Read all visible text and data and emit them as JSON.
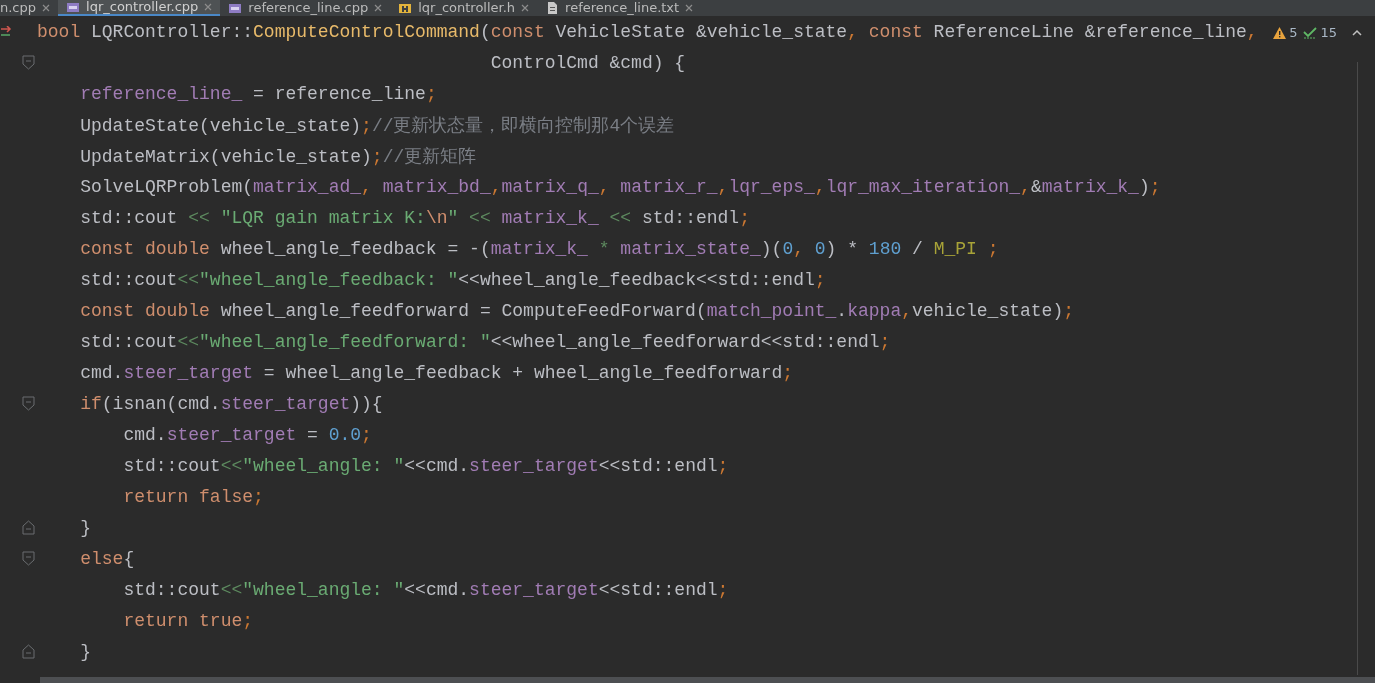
{
  "tabs": [
    {
      "label": "n.cpp",
      "selected": false
    },
    {
      "label": "lqr_controller.cpp",
      "selected": true,
      "kind": "cpp"
    },
    {
      "label": "reference_line.cpp",
      "selected": false,
      "kind": "cpp"
    },
    {
      "label": "lqr_controller.h",
      "selected": false,
      "kind": "h"
    },
    {
      "label": "reference_line.txt",
      "selected": false,
      "kind": "txt"
    }
  ],
  "inspections": {
    "warnings": "5",
    "weak_warnings": "15"
  },
  "lines": [
    {
      "gutter_arrow": true,
      "tokens": [
        {
          "kind": "kw",
          "text": "bool "
        },
        {
          "kind": "plain",
          "text": "LQRController::"
        },
        {
          "kind": "fn",
          "text": "ComputeControlCommand"
        },
        {
          "kind": "plain",
          "text": "("
        },
        {
          "kind": "kw",
          "text": "const "
        },
        {
          "kind": "plain",
          "text": "VehicleState &vehicle_state"
        },
        {
          "kind": "semi",
          "text": ", "
        },
        {
          "kind": "kw",
          "text": "const "
        },
        {
          "kind": "plain",
          "text": "ReferenceLine &reference_line"
        },
        {
          "kind": "semi",
          "text": ","
        }
      ]
    },
    {
      "fold_start": true,
      "tokens": [
        {
          "kind": "plain",
          "text": "                                          ControlCmd &cmd) {"
        }
      ]
    },
    {
      "tokens": [
        {
          "kind": "member",
          "text": "    reference_line_"
        },
        {
          "kind": "plain",
          "text": " = reference_line"
        },
        {
          "kind": "semi",
          "text": ";"
        }
      ]
    },
    {
      "tokens": [
        {
          "kind": "plain",
          "text": "    UpdateState(vehicle_state)"
        },
        {
          "kind": "semi",
          "text": ";"
        },
        {
          "kind": "comment",
          "text": "//更新状态量，即横向控制那4个误差"
        }
      ]
    },
    {
      "tokens": [
        {
          "kind": "plain",
          "text": "    UpdateMatrix(vehicle_state)"
        },
        {
          "kind": "semi",
          "text": ";"
        },
        {
          "kind": "comment",
          "text": "//更新矩阵"
        }
      ]
    },
    {
      "tokens": [
        {
          "kind": "plain",
          "text": "    SolveLQRProblem("
        },
        {
          "kind": "member",
          "text": "matrix_ad_"
        },
        {
          "kind": "semi",
          "text": ", "
        },
        {
          "kind": "member",
          "text": "matrix_bd_"
        },
        {
          "kind": "semi",
          "text": ","
        },
        {
          "kind": "member",
          "text": "matrix_q_"
        },
        {
          "kind": "semi",
          "text": ", "
        },
        {
          "kind": "member",
          "text": "matrix_r_"
        },
        {
          "kind": "semi",
          "text": ","
        },
        {
          "kind": "member",
          "text": "lqr_eps_"
        },
        {
          "kind": "semi",
          "text": ","
        },
        {
          "kind": "member",
          "text": "lqr_max_iteration_"
        },
        {
          "kind": "semi",
          "text": ","
        },
        {
          "kind": "plain",
          "text": "&"
        },
        {
          "kind": "member",
          "text": "matrix_k_"
        },
        {
          "kind": "plain",
          "text": ")"
        },
        {
          "kind": "semi",
          "text": ";"
        }
      ]
    },
    {
      "tokens": [
        {
          "kind": "plain",
          "text": "    std::cout "
        },
        {
          "kind": "op",
          "text": "<< "
        },
        {
          "kind": "str",
          "text": "\"LQR gain matrix K:"
        },
        {
          "kind": "esc",
          "text": "\\n"
        },
        {
          "kind": "str",
          "text": "\" "
        },
        {
          "kind": "op",
          "text": "<< "
        },
        {
          "kind": "member",
          "text": "matrix_k_ "
        },
        {
          "kind": "op",
          "text": "<< "
        },
        {
          "kind": "plain",
          "text": "std::endl"
        },
        {
          "kind": "semi",
          "text": ";"
        }
      ]
    },
    {
      "tokens": [
        {
          "kind": "kw",
          "text": "    const double "
        },
        {
          "kind": "plain",
          "text": "wheel_angle_feedback = -("
        },
        {
          "kind": "member",
          "text": "matrix_k_ "
        },
        {
          "kind": "op",
          "text": "* "
        },
        {
          "kind": "member",
          "text": "matrix_state_"
        },
        {
          "kind": "plain",
          "text": ")("
        },
        {
          "kind": "num",
          "text": "0"
        },
        {
          "kind": "semi",
          "text": ", "
        },
        {
          "kind": "num",
          "text": "0"
        },
        {
          "kind": "plain",
          "text": ") * "
        },
        {
          "kind": "num",
          "text": "180 "
        },
        {
          "kind": "plain",
          "text": "/ "
        },
        {
          "kind": "macro",
          "text": "M_PI "
        },
        {
          "kind": "semi",
          "text": ";"
        }
      ]
    },
    {
      "tokens": [
        {
          "kind": "plain",
          "text": "    std::cout"
        },
        {
          "kind": "op",
          "text": "<<"
        },
        {
          "kind": "str",
          "text": "\"wheel_angle_feedback: \""
        },
        {
          "kind": "plain",
          "text": "<<wheel_angle_feedback<<std::endl"
        },
        {
          "kind": "semi",
          "text": ";"
        }
      ]
    },
    {
      "tokens": [
        {
          "kind": "kw",
          "text": "    const double "
        },
        {
          "kind": "plain",
          "text": "wheel_angle_feedforward = ComputeFeedForward("
        },
        {
          "kind": "member",
          "text": "match_point_"
        },
        {
          "kind": "plain",
          "text": "."
        },
        {
          "kind": "member",
          "text": "kappa"
        },
        {
          "kind": "semi",
          "text": ","
        },
        {
          "kind": "plain",
          "text": "vehicle_state)"
        },
        {
          "kind": "semi",
          "text": ";"
        }
      ]
    },
    {
      "tokens": [
        {
          "kind": "plain",
          "text": "    std::cout"
        },
        {
          "kind": "op",
          "text": "<<"
        },
        {
          "kind": "str",
          "text": "\"wheel_angle_feedforward: \""
        },
        {
          "kind": "plain",
          "text": "<<wheel_angle_feedforward<<std::endl"
        },
        {
          "kind": "semi",
          "text": ";"
        }
      ]
    },
    {
      "tokens": [
        {
          "kind": "plain",
          "text": "    cmd."
        },
        {
          "kind": "member",
          "text": "steer_target"
        },
        {
          "kind": "plain",
          "text": " = wheel_angle_feedback + wheel_angle_feedforward"
        },
        {
          "kind": "semi",
          "text": ";"
        }
      ]
    },
    {
      "fold_start": true,
      "tokens": [
        {
          "kind": "kw",
          "text": "    if"
        },
        {
          "kind": "plain",
          "text": "(isnan(cmd."
        },
        {
          "kind": "member",
          "text": "steer_target"
        },
        {
          "kind": "plain",
          "text": ")){"
        }
      ]
    },
    {
      "tokens": [
        {
          "kind": "plain",
          "text": "        cmd."
        },
        {
          "kind": "member",
          "text": "steer_target"
        },
        {
          "kind": "plain",
          "text": " = "
        },
        {
          "kind": "num",
          "text": "0.0"
        },
        {
          "kind": "semi",
          "text": ";"
        }
      ]
    },
    {
      "tokens": [
        {
          "kind": "plain",
          "text": "        std::cout"
        },
        {
          "kind": "op",
          "text": "<<"
        },
        {
          "kind": "str",
          "text": "\"wheel_angle: \""
        },
        {
          "kind": "plain",
          "text": "<<cmd."
        },
        {
          "kind": "member",
          "text": "steer_target"
        },
        {
          "kind": "plain",
          "text": "<<std::endl"
        },
        {
          "kind": "semi",
          "text": ";"
        }
      ]
    },
    {
      "tokens": [
        {
          "kind": "kw",
          "text": "        return false"
        },
        {
          "kind": "semi",
          "text": ";"
        }
      ]
    },
    {
      "fold_end": true,
      "tokens": [
        {
          "kind": "plain",
          "text": "    }"
        }
      ]
    },
    {
      "fold_start": true,
      "tokens": [
        {
          "kind": "kw",
          "text": "    else"
        },
        {
          "kind": "plain",
          "text": "{"
        }
      ]
    },
    {
      "tokens": [
        {
          "kind": "plain",
          "text": "        std::cout"
        },
        {
          "kind": "op",
          "text": "<<"
        },
        {
          "kind": "str",
          "text": "\"wheel_angle: \""
        },
        {
          "kind": "plain",
          "text": "<<cmd."
        },
        {
          "kind": "member",
          "text": "steer_target"
        },
        {
          "kind": "plain",
          "text": "<<std::endl"
        },
        {
          "kind": "semi",
          "text": ";"
        }
      ]
    },
    {
      "tokens": [
        {
          "kind": "kw",
          "text": "        return true"
        },
        {
          "kind": "semi",
          "text": ";"
        }
      ]
    },
    {
      "fold_end": true,
      "tokens": [
        {
          "kind": "plain",
          "text": "    }"
        }
      ]
    }
  ]
}
